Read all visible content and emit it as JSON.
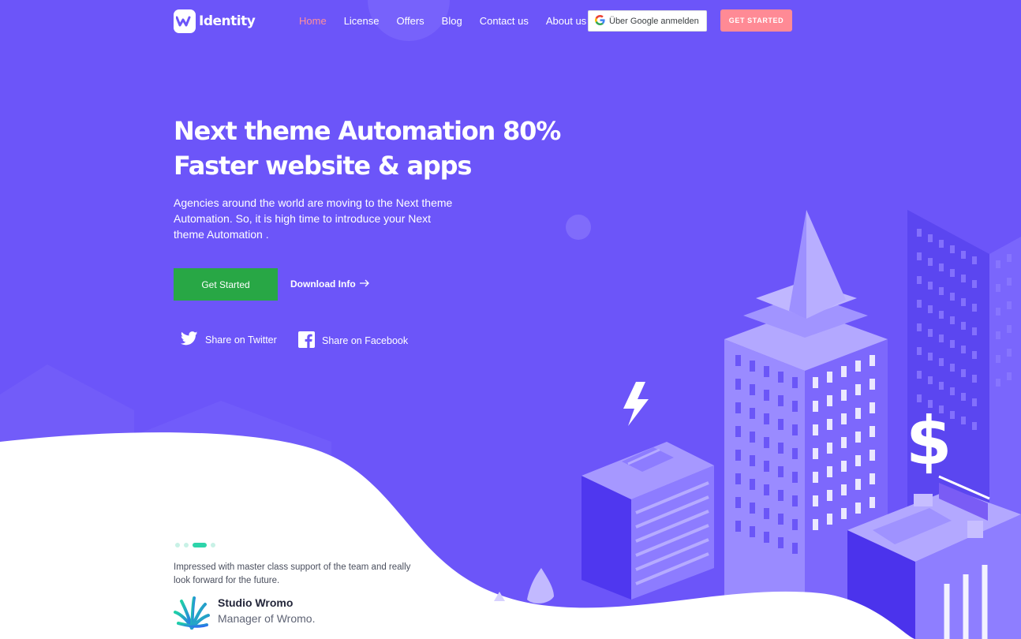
{
  "brand": {
    "name": "Identity",
    "logo_icon": "wave-logo-icon"
  },
  "nav": {
    "items": [
      {
        "label": "Home",
        "active": true
      },
      {
        "label": "License",
        "active": false
      },
      {
        "label": "Offers",
        "active": false
      },
      {
        "label": "Blog",
        "active": false
      },
      {
        "label": "Contact us",
        "active": false
      },
      {
        "label": "About us",
        "active": false
      }
    ],
    "google_signin_label": "Über Google anmelden",
    "cta_label": "GET STARTED"
  },
  "hero": {
    "title_line1": "Next theme Automation 80%",
    "title_line2": "Faster website & apps",
    "subtitle": "Agencies around the world are moving to the Next theme Automation. So, it is high time to introduce your Next theme Automation .",
    "primary_button": "Get Started",
    "secondary_link": "Download Info",
    "share_twitter": "Share on Twitter",
    "share_facebook": "Share on Facebook"
  },
  "testimonial": {
    "slides": 4,
    "active_slide": 3,
    "quote": "Impressed with master class support of the team and really look forward for the future.",
    "author_name": "Studio Wromo",
    "author_role": "Manager of Wromo."
  },
  "colors": {
    "background": "#6c55f9",
    "active_nav": "#ff8f9b",
    "cta": "#ff8a95",
    "primary_button": "#28a745",
    "dot_active": "#2dd4aa"
  }
}
